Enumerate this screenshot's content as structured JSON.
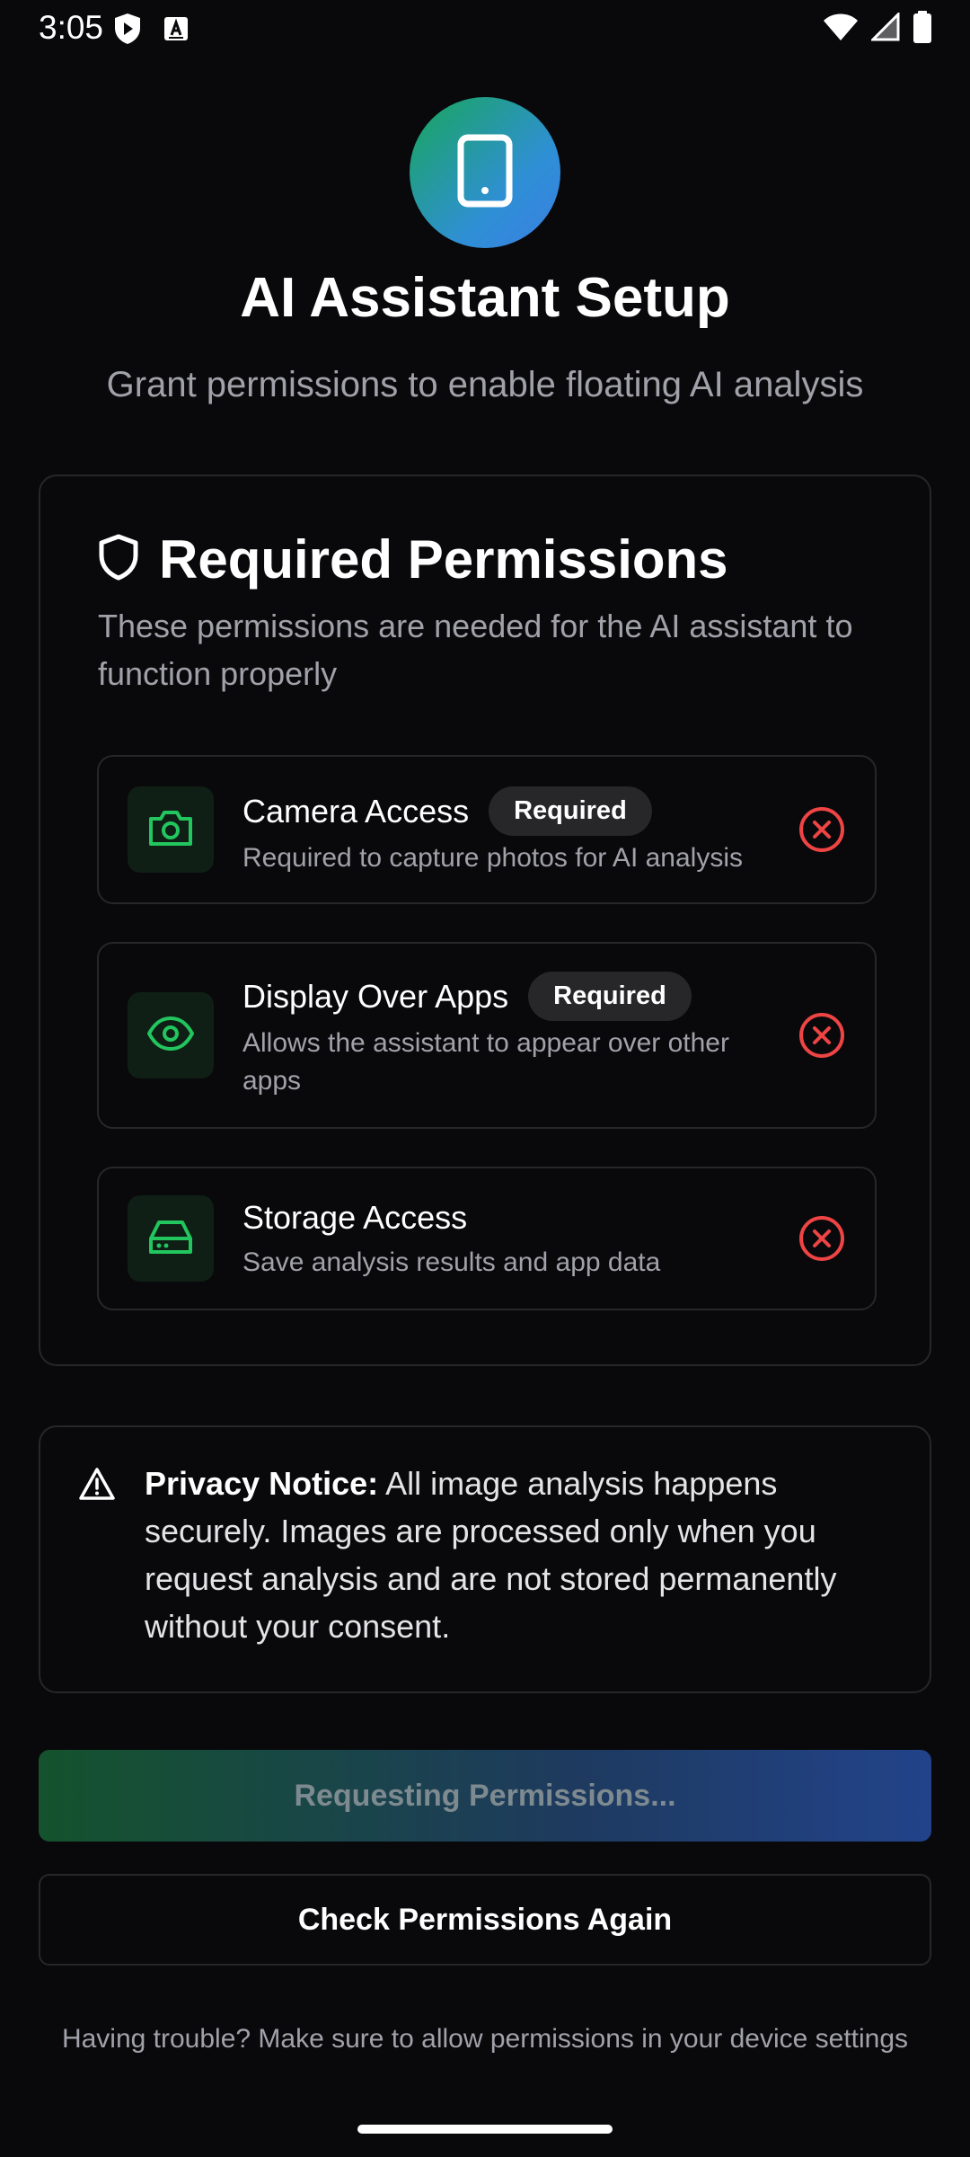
{
  "status_bar": {
    "time": "3:05",
    "left_icons": [
      "shield-play-icon",
      "keyboard-a-icon"
    ],
    "right_icons": [
      "wifi-icon",
      "signal-icon",
      "battery-icon"
    ]
  },
  "header": {
    "icon": "smartphone-icon",
    "title": "AI Assistant Setup",
    "subtitle": "Grant permissions to enable floating AI analysis"
  },
  "permissions_card": {
    "icon": "shield-icon",
    "title": "Required Permissions",
    "description": "These permissions are needed for the AI assistant to function properly",
    "items": [
      {
        "icon": "camera-icon",
        "title": "Camera Access",
        "badge": "Required",
        "description": "Required to capture photos for AI analysis",
        "status": "not-granted"
      },
      {
        "icon": "eye-icon",
        "title": "Display Over Apps",
        "badge": "Required",
        "description": "Allows the assistant to appear over other apps",
        "status": "not-granted"
      },
      {
        "icon": "hard-drive-icon",
        "title": "Storage Access",
        "badge": "",
        "description": "Save analysis results and app data",
        "status": "not-granted"
      }
    ]
  },
  "privacy": {
    "icon": "warning-triangle-icon",
    "label": "Privacy Notice:",
    "text": "All image analysis happens securely. Images are processed only when you request analysis and are not stored permanently without your consent."
  },
  "actions": {
    "primary_label": "Requesting Permissions...",
    "secondary_label": "Check Permissions Again"
  },
  "help_text": "Having trouble? Make sure to allow permissions in your device settings",
  "colors": {
    "background": "#09090b",
    "accent_green": "#22c55e",
    "error_red": "#ef4444",
    "border": "#27272a",
    "muted_text": "#a1a1aa"
  }
}
